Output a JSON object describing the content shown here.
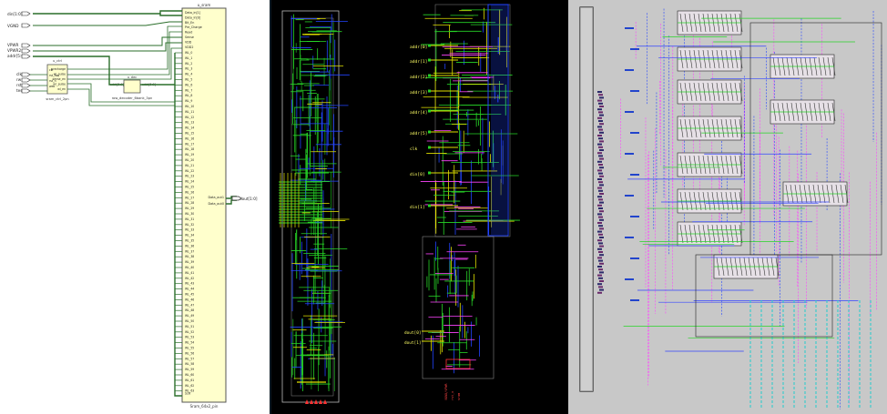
{
  "schematic": {
    "block_main": {
      "title": "u_sram",
      "footer": "Sram_64x2_pin",
      "pins_left": [
        "Data_in[1]",
        "Data_in[0]",
        "Bit_En",
        "Pre_Charge",
        "Read",
        "Sense",
        "VDD",
        "VDD2"
      ],
      "wl_prefix": "WL_",
      "wl_count": 64,
      "wl_last": "Sclk",
      "pins_right": [
        "Data_out1",
        "Data_out0"
      ]
    },
    "block_ctrl": {
      "title": "u_ctrl",
      "footer": "sram_ctrl_2pn",
      "pins_in": [
        "clk",
        "rst_req",
        "rst_n",
        "web"
      ],
      "pins_out": [
        "precharge",
        "wl_pulse",
        "sense_en",
        "wr_pulse",
        "wl_en"
      ]
    },
    "block_dec": {
      "title": "u_dec",
      "footer": "row_decoder_6bank_3pn",
      "pin_in": "addr[5:0]",
      "pin_out": "addr[5:0]"
    },
    "ports_in": [
      "din[1:0]",
      "VGND",
      "VPWR",
      "VPWR2",
      "addr[5:0]",
      "clk",
      "rw",
      "rst",
      "test"
    ],
    "port_out": "dout[1:0]"
  },
  "layout_mid": {
    "ports_left": [
      "addr[0]",
      "addr[1]",
      "addr[2]",
      "addr[3]",
      "addr[4]",
      "addr[5]",
      "clk",
      "din[0]",
      "din[1]"
    ],
    "ports_bottom_left": [
      "dout[0]",
      "dout[1]"
    ],
    "bottom_labels": [
      "VGND/VPWR",
      "rst_n",
      "sram"
    ]
  },
  "colors": {
    "wire": "#2a6e2a",
    "block": "#ffffcc",
    "green": "#27d427",
    "yellow": "#e0e000",
    "blue": "#2244ff",
    "magenta": "#ff44ff",
    "cyan": "#22cccc",
    "red": "#ff3333"
  }
}
